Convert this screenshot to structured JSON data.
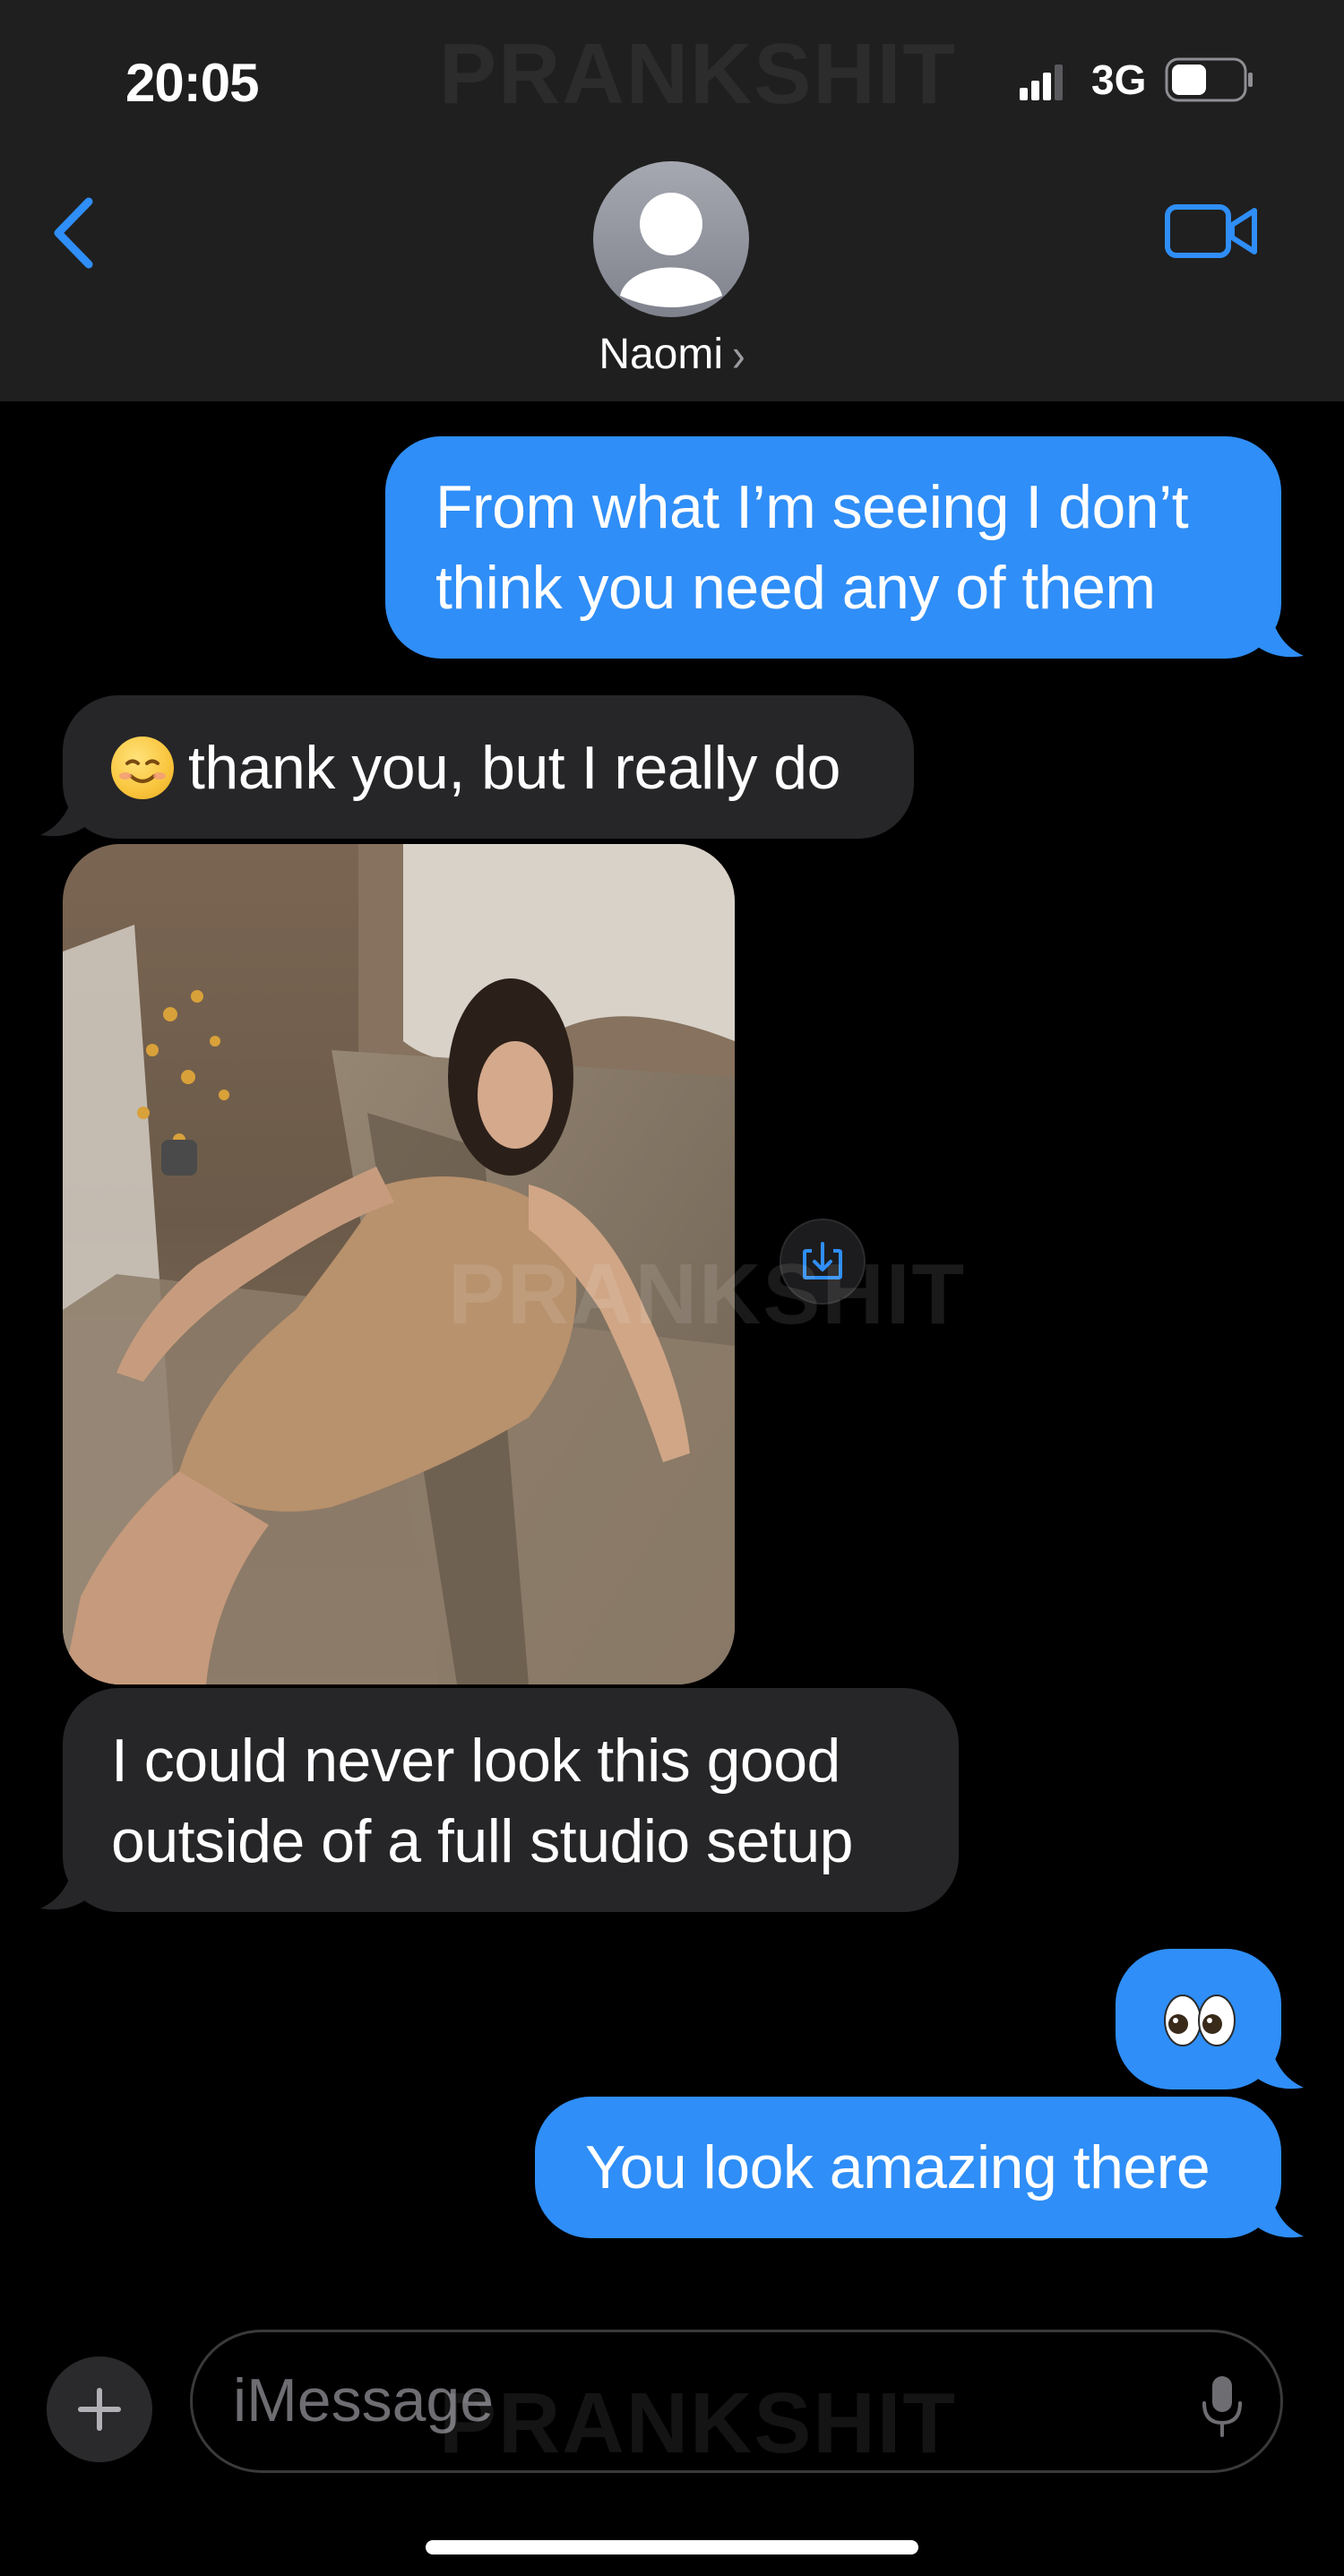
{
  "status_bar": {
    "time": "20:05",
    "network": "3G"
  },
  "watermark": "PRANKSHIT",
  "header": {
    "contact_name": "Naomi",
    "chevron": "›",
    "back_icon": "chevron-left-icon",
    "video_icon": "video-camera-icon"
  },
  "messages": [
    {
      "direction": "sent",
      "text_lines": [
        "From what I’m seeing I don’t",
        "think you need any of them"
      ]
    },
    {
      "direction": "received",
      "emoji": "☺️",
      "text": "thank you, but I really do"
    },
    {
      "direction": "received",
      "type": "photo"
    },
    {
      "direction": "received",
      "text_lines": [
        "I could never look this good",
        "outside of a full studio setup"
      ]
    },
    {
      "direction": "sent",
      "emoji": "👀"
    },
    {
      "direction": "sent",
      "text": "You look amazing there"
    }
  ],
  "input": {
    "placeholder": "iMessage"
  },
  "colors": {
    "sent_bubble": "#2f8ef7",
    "received_bubble": "#262628",
    "accent": "#2f8ef7",
    "header_bg": "#1f1f1f"
  }
}
